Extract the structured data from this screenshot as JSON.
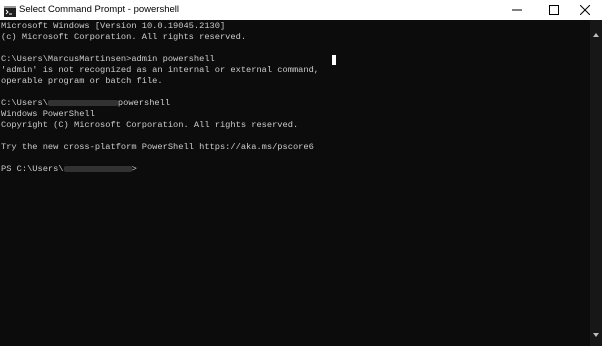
{
  "window": {
    "title": "Select Command Prompt - powershell",
    "icon": "command-prompt-icon",
    "controls": {
      "minimize_icon": "minimize-icon",
      "maximize_icon": "maximize-icon",
      "close_icon": "close-icon"
    }
  },
  "terminal": {
    "lines": [
      "Microsoft Windows [Version 10.0.19045.2130]",
      "(c) Microsoft Corporation. All rights reserved.",
      "",
      "C:\\Users\\MarcusMartinsen>admin powershell",
      "'admin' is not recognized as an internal or external command,",
      "operable program or batch file.",
      "",
      "C:\\Users\\",
      "powershell",
      "Windows PowerShell",
      "Copyright (C) Microsoft Corporation. All rights reserved.",
      "",
      "Try the new cross-platform PowerShell https://aka.ms/pscore6",
      "",
      "PS C:\\Users\\",
      ">"
    ]
  },
  "colors": {
    "background": "#0c0c0c",
    "text": "#cccccc",
    "titlebar": "#ffffff"
  }
}
